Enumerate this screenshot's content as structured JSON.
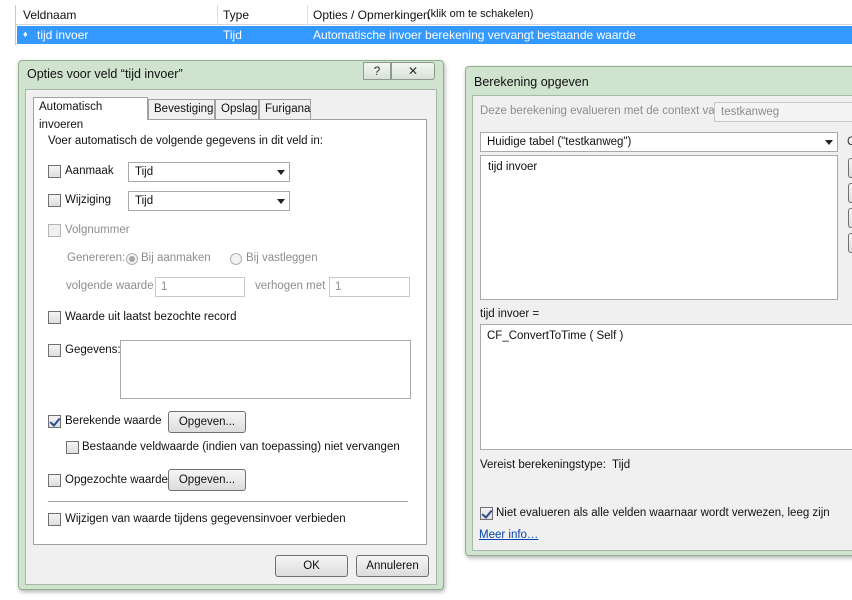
{
  "field_table": {
    "headers": [
      "Veldnaam",
      "Type",
      "Opties / Opmerkingen",
      "(klik om te schakelen)"
    ],
    "selected_row": {
      "marker": "♦",
      "name": "tijd invoer",
      "type": "Tijd",
      "options": "Automatische invoer berekening vervangt bestaande waarde"
    }
  },
  "options_dialog": {
    "title": "Opties voor veld “tijd invoer”",
    "help_label": "?",
    "tabs": [
      "Automatisch invoeren",
      "Bevestiging",
      "Opslag",
      "Furigana"
    ],
    "intro": "Voer automatisch de volgende gegevens in dit veld in:",
    "aanmaak": {
      "label": "Aanmaak",
      "value": "Tijd"
    },
    "wijziging": {
      "label": "Wijziging",
      "value": "Tijd"
    },
    "volgnummer": {
      "label": "Volgnummer",
      "genereren_label": "Genereren:",
      "radio_aanmaken": "Bij aanmaken",
      "radio_vastleggen": "Bij vastleggen",
      "next_label": "volgende waarde",
      "next_value": "1",
      "incr_label": "verhogen met",
      "incr_value": "1"
    },
    "last_record_label": "Waarde uit laatst bezochte record",
    "gegevens_label": "Gegevens:",
    "berekende_label": "Berekende waarde",
    "opgeven_label": "Opgeven...",
    "bestaande_label": "Bestaande veldwaarde (indien van toepassing) niet vervangen",
    "opgezochte_label": "Opgezochte waarde",
    "opgeven2_label": "Opgeven...",
    "wijzigen_label": "Wijzigen van waarde tijdens gegevensinvoer verbieden",
    "ok_label": "OK",
    "cancel_label": "Annuleren"
  },
  "calc_dialog": {
    "title": "Berekening opgeven",
    "context_label": "Deze berekening evalueren met de context van:",
    "context_value": "testkanweg",
    "table_select": "Huidige tabel (\"testkanweg\")",
    "field_list": [
      "tijd invoer"
    ],
    "calc_label": "tijd invoer =",
    "formula": "CF_ConvertToTime ( Self )",
    "result_type_label": "Vereist berekeningstype:",
    "result_type": "Tijd",
    "no_eval_label": "Niet evalueren als alle velden waarnaar wordt verwezen, leeg zijn",
    "more_info": "Meer info…",
    "cut_char": "C"
  }
}
